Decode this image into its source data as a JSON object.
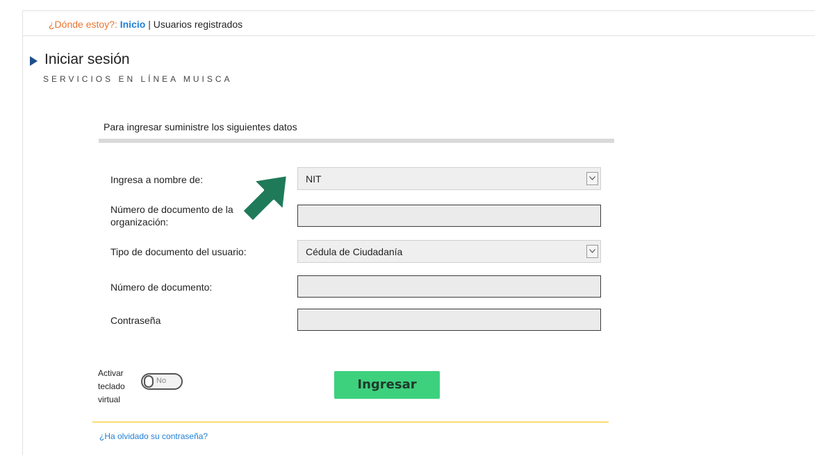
{
  "breadcrumb": {
    "prefix": "¿Dónde estoy?:",
    "home": "Inicio",
    "separator": "|",
    "current": "Usuarios registrados"
  },
  "header": {
    "title": "Iniciar sesión",
    "subtitle": "SERVICIOS EN LÍNEA MUISCA"
  },
  "form": {
    "instructions": "Para ingresar suministre los siguientes datos",
    "fields": [
      {
        "label": "Ingresa a nombre de:",
        "value": "NIT"
      },
      {
        "label": "Número de documento de la organización:",
        "value": ""
      },
      {
        "label": "Tipo de documento del usuario:",
        "value": "Cédula de Ciudadanía"
      },
      {
        "label": "Número de documento:",
        "value": ""
      },
      {
        "label": "Contraseña",
        "value": ""
      }
    ],
    "virtual_keyboard": {
      "label_line1": "Activar",
      "label_line2": "teclado",
      "label_line3": "virtual",
      "state": "No"
    },
    "submit_label": "Ingresar",
    "forgot_link": "¿Ha olvidado su contraseña?"
  },
  "colors": {
    "accent_orange": "#e8742d",
    "link_blue": "#1f7fd6",
    "button_green": "#3dd17e",
    "pointer_green": "#1f7a5a",
    "rule_yellow": "#f2c100"
  },
  "icons": [
    "title-arrow-icon",
    "chevron-down-icon",
    "pointer-arrow-icon"
  ]
}
